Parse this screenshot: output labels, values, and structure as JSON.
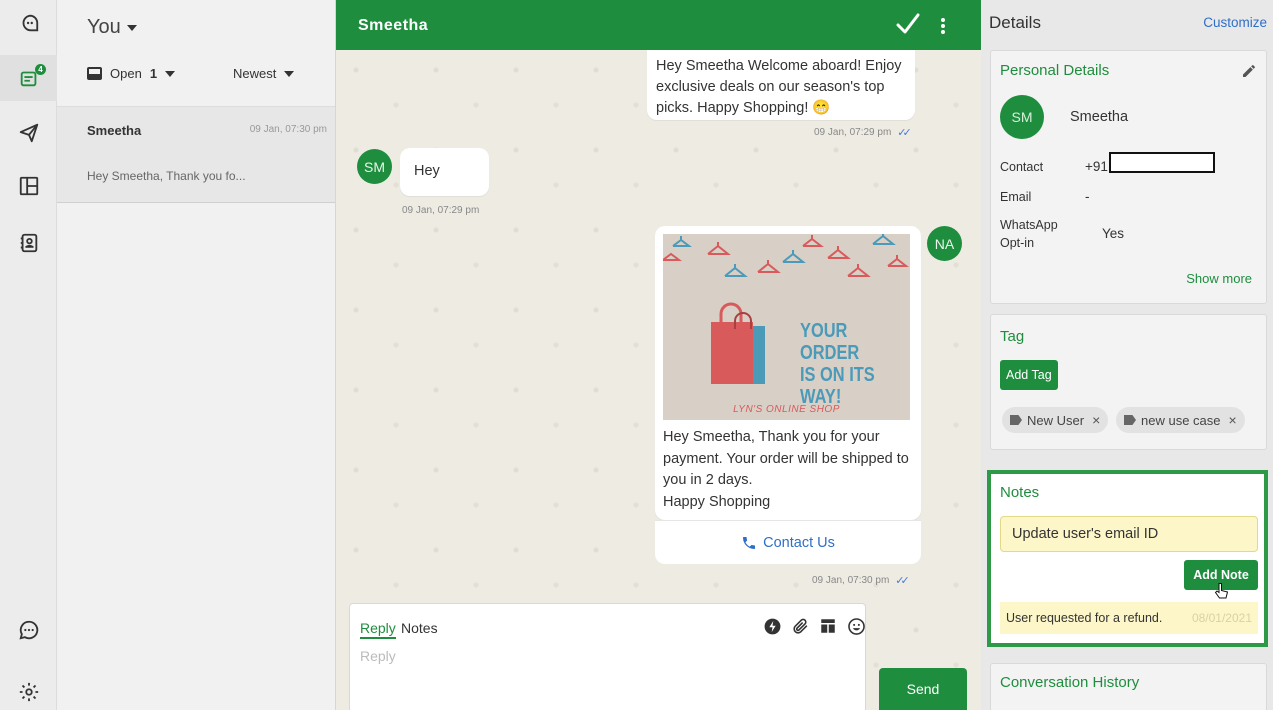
{
  "rail": {
    "badge_count": "4"
  },
  "list": {
    "title": "You",
    "filter_status": "Open",
    "filter_count": "1",
    "sort": "Newest",
    "conversations": [
      {
        "name": "Smeetha",
        "time": "09 Jan, 07:30 pm",
        "preview": "Hey Smeetha, Thank you fo..."
      }
    ]
  },
  "chat": {
    "contact_name": "Smeetha",
    "messages": [
      {
        "text": "Hey Smeetha Welcome aboard! Enjoy exclusive deals on our season's top picks. Happy Shopping! 😁",
        "time": "09 Jan, 07:29 pm"
      },
      {
        "avatar": "SM",
        "text": "Hey",
        "time": "09 Jan, 07:29 pm"
      },
      {
        "avatar": "NA",
        "image_headline_lines": [
          "YOUR ORDER",
          "IS ON ITS",
          "WAY!"
        ],
        "image_shop": "LYN'S ONLINE SHOP",
        "text_lines": [
          "Hey Smeetha, Thank you for your payment. Your order will be shipped to you in 2 days.",
          "Happy Shopping"
        ],
        "button": "Contact Us",
        "time": "09 Jan, 07:30 pm"
      }
    ],
    "reply": {
      "tab_reply": "Reply",
      "tab_notes": "Notes",
      "placeholder": "Reply",
      "send": "Send"
    }
  },
  "details": {
    "title": "Details",
    "customize": "Customize",
    "personal": {
      "title": "Personal Details",
      "initials": "SM",
      "name": "Smeetha",
      "contact_label": "Contact",
      "contact_value": "+91",
      "email_label": "Email",
      "email_value": "-",
      "whatsapp_label_1": "WhatsApp",
      "whatsapp_label_2": "Opt-in",
      "whatsapp_value": "Yes",
      "show_more": "Show more"
    },
    "tag": {
      "title": "Tag",
      "add_tag": "Add Tag",
      "tags": [
        "New User",
        "new use case"
      ]
    },
    "notes": {
      "title": "Notes",
      "input_value": "Update user's email ID",
      "add_note": "Add Note",
      "items": [
        {
          "text": "User requested for a refund.",
          "date": "08/01/2021"
        }
      ]
    },
    "history": {
      "title": "Conversation History"
    }
  },
  "colors": {
    "brand_green": "#1e8e3e",
    "link_blue": "#2f6fc7",
    "note_yellow": "#fdf6c8",
    "tick_blue": "#4a7bd0"
  },
  "icons": [
    "chat-logo-icon",
    "inbox-icon",
    "send-plane-icon",
    "layout-icon",
    "contacts-icon",
    "chat-bubble-icon",
    "settings-icon",
    "check-icon",
    "more-vertical-icon",
    "phone-icon",
    "lightning-icon",
    "paperclip-icon",
    "template-icon",
    "emoji-icon",
    "pencil-icon",
    "tag-icon",
    "pointer-cursor-icon"
  ]
}
